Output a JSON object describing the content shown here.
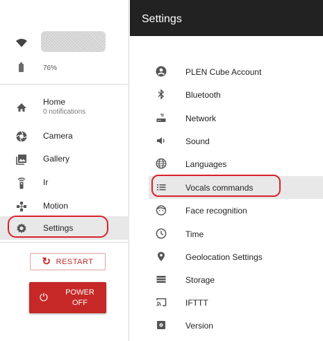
{
  "sidebar": {
    "battery": "76%",
    "nav": [
      {
        "label": "Home",
        "sublabel": "0 notifications",
        "icon": "home-icon"
      },
      {
        "label": "Camera",
        "icon": "camera-icon"
      },
      {
        "label": "Gallery",
        "icon": "gallery-icon"
      },
      {
        "label": "Ir",
        "icon": "remote-icon"
      },
      {
        "label": "Motion",
        "icon": "motion-icon"
      },
      {
        "label": "Settings",
        "icon": "gear-icon",
        "active": true
      }
    ],
    "restart_label": "RESTART",
    "power_label_1": "POWER",
    "power_label_2": "OFF"
  },
  "header": {
    "title": "Settings"
  },
  "settings": [
    {
      "label": "PLEN Cube Account",
      "icon": "account-icon"
    },
    {
      "label": "Bluetooth",
      "icon": "bluetooth-icon"
    },
    {
      "label": "Network",
      "icon": "router-icon"
    },
    {
      "label": "Sound",
      "icon": "speaker-icon"
    },
    {
      "label": "Languages",
      "icon": "globe-icon"
    },
    {
      "label": "Vocals commands",
      "icon": "list-icon",
      "highlighted": true
    },
    {
      "label": "Face recognition",
      "icon": "face-icon"
    },
    {
      "label": "Time",
      "icon": "clock-icon"
    },
    {
      "label": "Geolocation Settings",
      "icon": "location-icon"
    },
    {
      "label": "Storage",
      "icon": "storage-icon"
    },
    {
      "label": "IFTTT",
      "icon": "cast-icon"
    },
    {
      "label": "Version",
      "icon": "version-icon"
    }
  ],
  "colors": {
    "accent": "#c62828",
    "header_bg": "#222222",
    "highlight_ring": "#d9202b",
    "icon": "#555555"
  }
}
